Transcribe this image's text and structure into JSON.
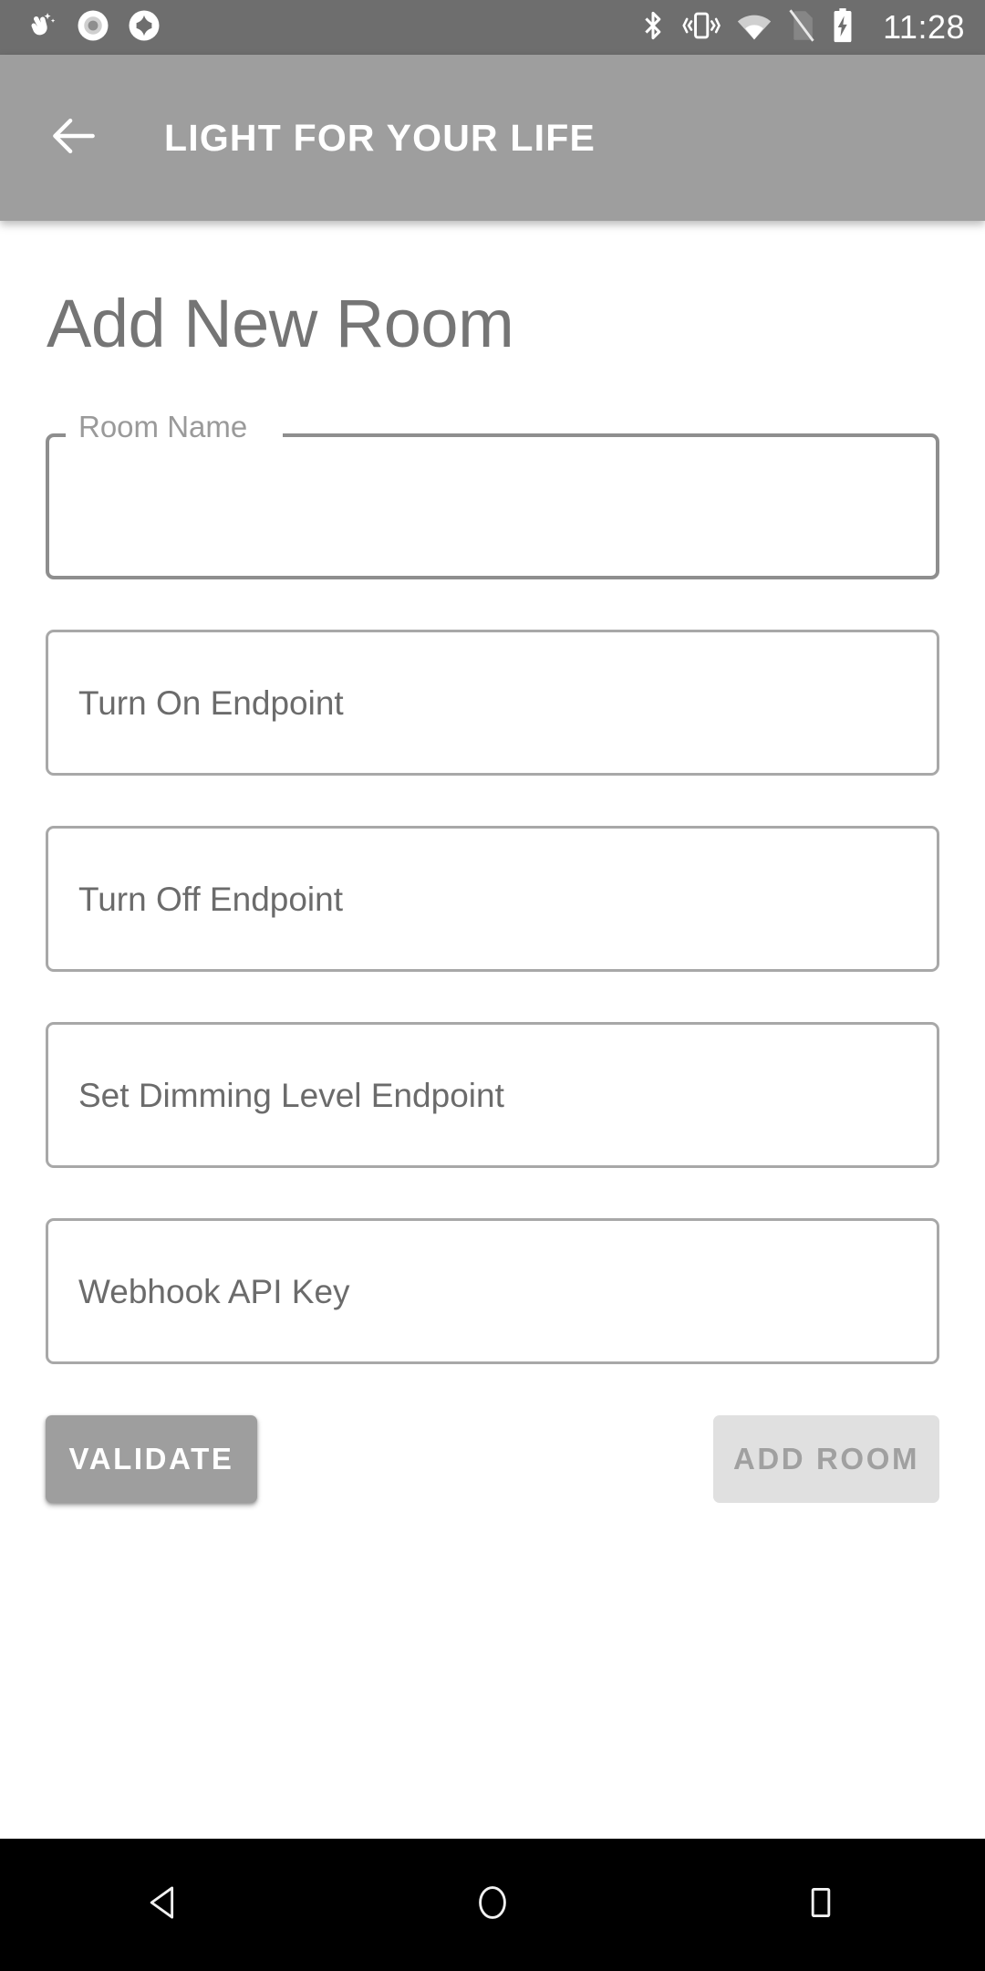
{
  "status_bar": {
    "time": "11:28",
    "background": "#6e6e6e",
    "notification_icons": [
      "sparkle-hand-icon",
      "circle-dot-icon",
      "diamond-circle-icon"
    ],
    "system_icons": [
      "bluetooth-icon",
      "vibrate-icon",
      "wifi-icon",
      "no-sim-icon",
      "battery-charging-icon"
    ]
  },
  "app_bar": {
    "title": "LIGHT FOR YOUR LIFE",
    "back_icon": "arrow-left-icon",
    "background": "#9e9e9e",
    "title_color": "#ffffff"
  },
  "page": {
    "heading": "Add New Room",
    "heading_color": "#757575"
  },
  "fields": [
    {
      "name": "room-name",
      "label": "Room Name",
      "value": "",
      "state": "focused",
      "label_style": "floating-notch"
    },
    {
      "name": "turn-on-endpoint",
      "label": "Turn On Endpoint",
      "value": "",
      "state": "empty",
      "label_style": "placeholder"
    },
    {
      "name": "turn-off-endpoint",
      "label": "Turn Off Endpoint",
      "value": "",
      "state": "empty",
      "label_style": "placeholder"
    },
    {
      "name": "set-dimming-level-endpoint",
      "label": "Set Dimming Level Endpoint",
      "value": "",
      "state": "empty",
      "label_style": "placeholder"
    },
    {
      "name": "webhook-api-key",
      "label": "Webhook API Key",
      "value": "",
      "state": "empty",
      "label_style": "placeholder"
    }
  ],
  "buttons": {
    "validate": {
      "label": "VALIDATE",
      "enabled": true,
      "background": "#9e9e9e",
      "text_color": "#ffffff"
    },
    "add_room": {
      "label": "ADD ROOM",
      "enabled": false,
      "background": "#e0e0e0",
      "text_color": "#a0a0a0"
    }
  },
  "nav_bar": {
    "background": "#000000",
    "buttons": [
      "back-triangle-icon",
      "home-circle-icon",
      "recents-square-icon"
    ]
  }
}
